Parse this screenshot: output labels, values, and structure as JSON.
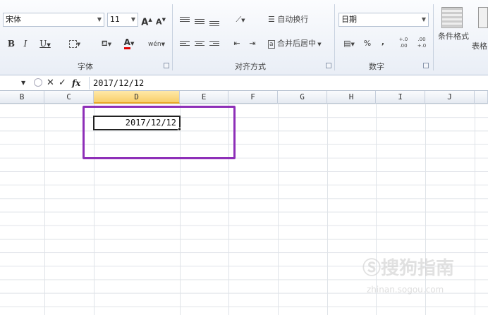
{
  "ribbon": {
    "font": {
      "font_name": "宋体",
      "font_size": "11",
      "grow_font": "A",
      "shrink_font": "A",
      "bold": "B",
      "italic": "I",
      "underline": "U",
      "font_color": "A",
      "phonetic": "wén",
      "group_label": "字体"
    },
    "alignment": {
      "wrap_text": "自动换行",
      "merge_center": "合并后居中",
      "group_label": "对齐方式"
    },
    "number": {
      "format": "日期",
      "percent": "%",
      "comma": ",",
      "inc_decimal": "+.0 .00",
      "dec_decimal": ".00 +.0",
      "group_label": "数字"
    },
    "styles": {
      "conditional_formatting": "条件格式",
      "format_as_table": "表格"
    }
  },
  "formula_bar": {
    "fx": "fx",
    "content": "2017/12/12"
  },
  "columns": [
    "B",
    "C",
    "D",
    "E",
    "F",
    "G",
    "H",
    "I",
    "J"
  ],
  "active_column": "D",
  "cells": {
    "d_value": "2017/12/12"
  },
  "colors": {
    "highlight": "#8e2fb8",
    "active_header": "#f8cf6b",
    "font_color_bar": "#e00000"
  },
  "watermark": {
    "brand": "搜狗指南",
    "url": "zhinan.sogou.com"
  }
}
